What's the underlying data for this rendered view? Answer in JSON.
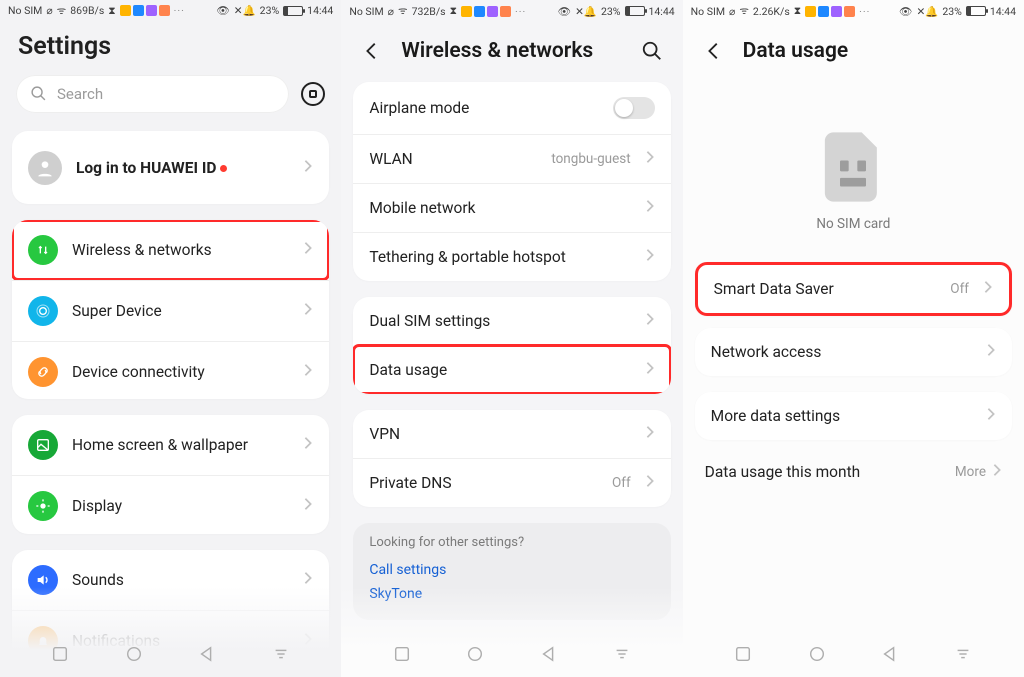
{
  "status": {
    "left_items": [
      "No SIM",
      "⎋",
      "📶"
    ],
    "net": [
      "869B/s",
      "732B/s",
      "2.26K/s"
    ],
    "icons_right": [
      "👁",
      "🔕"
    ],
    "battery_pct": "23%",
    "time": "14:44"
  },
  "screen1": {
    "title": "Settings",
    "search_placeholder": "Search",
    "login_label": "Log in to HUAWEI ID",
    "items": [
      {
        "label": "Wireless & networks"
      },
      {
        "label": "Super Device"
      },
      {
        "label": "Device connectivity"
      }
    ],
    "items2": [
      {
        "label": "Home screen & wallpaper"
      },
      {
        "label": "Display"
      }
    ],
    "items3": [
      {
        "label": "Sounds"
      },
      {
        "label": "Notifications"
      }
    ]
  },
  "screen2": {
    "title": "Wireless & networks",
    "group1": [
      {
        "label": "Airplane mode",
        "toggle": true
      },
      {
        "label": "WLAN",
        "value": "tongbu-guest"
      },
      {
        "label": "Mobile network"
      },
      {
        "label": "Tethering & portable hotspot"
      }
    ],
    "group2": [
      {
        "label": "Dual SIM settings"
      },
      {
        "label": "Data usage"
      }
    ],
    "group3": [
      {
        "label": "VPN"
      },
      {
        "label": "Private DNS",
        "value": "Off"
      }
    ],
    "suggest_q": "Looking for other settings?",
    "suggest_links": [
      "Call settings",
      "SkyTone"
    ]
  },
  "screen3": {
    "title": "Data usage",
    "no_sim_label": "No SIM card",
    "group1": [
      {
        "label": "Smart Data Saver",
        "value": "Off"
      },
      {
        "label": "Network access"
      }
    ],
    "group2": [
      {
        "label": "More data settings"
      }
    ],
    "month_row": {
      "label": "Data usage this month",
      "value": "More"
    }
  }
}
